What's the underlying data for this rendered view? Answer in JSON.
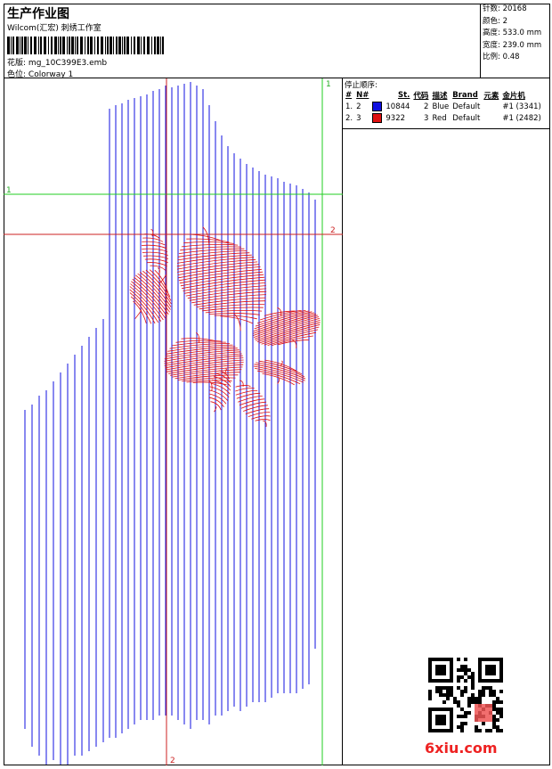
{
  "header": {
    "title": "生产作业图",
    "company": "Wilcom(汇宏) 刺绣工作室",
    "design_label": "花版:",
    "design_file": "mg_10C399E3.emb",
    "colorway_label": "色位:",
    "colorway": "Colorway 1"
  },
  "stats": [
    {
      "label": "针数:",
      "value": "20168"
    },
    {
      "label": "颜色:",
      "value": "2"
    },
    {
      "label": "高度:",
      "value": "533.0 mm"
    },
    {
      "label": "宽度:",
      "value": "239.0 mm"
    },
    {
      "label": "比例:",
      "value": "0.48"
    }
  ],
  "stop_sequence": {
    "title": "停止顺序:",
    "columns": [
      "#",
      "N#",
      "St.",
      "代码",
      "描述",
      "Brand",
      "元素",
      "金片机"
    ],
    "rows": [
      {
        "idx": "1.",
        "needle": "2",
        "color": "#1010e0",
        "stitches": "10844",
        "code": "2",
        "desc": "Blue",
        "brand": "Default",
        "element": "#1 (3341)"
      },
      {
        "idx": "2.",
        "needle": "3",
        "color": "#e01010",
        "stitches": "9322",
        "code": "3",
        "desc": "Red",
        "brand": "Default",
        "element": "#1 (2482)"
      }
    ]
  },
  "guides": {
    "green_h": "1",
    "green_v": "1",
    "red_h": "2",
    "red_v": "2"
  },
  "colors": {
    "blue_thread": "#1010e0",
    "red_thread": "#e01010",
    "green_guide": "#22cc22",
    "red_guide": "#cc2222"
  },
  "watermark": "6xiu.com"
}
